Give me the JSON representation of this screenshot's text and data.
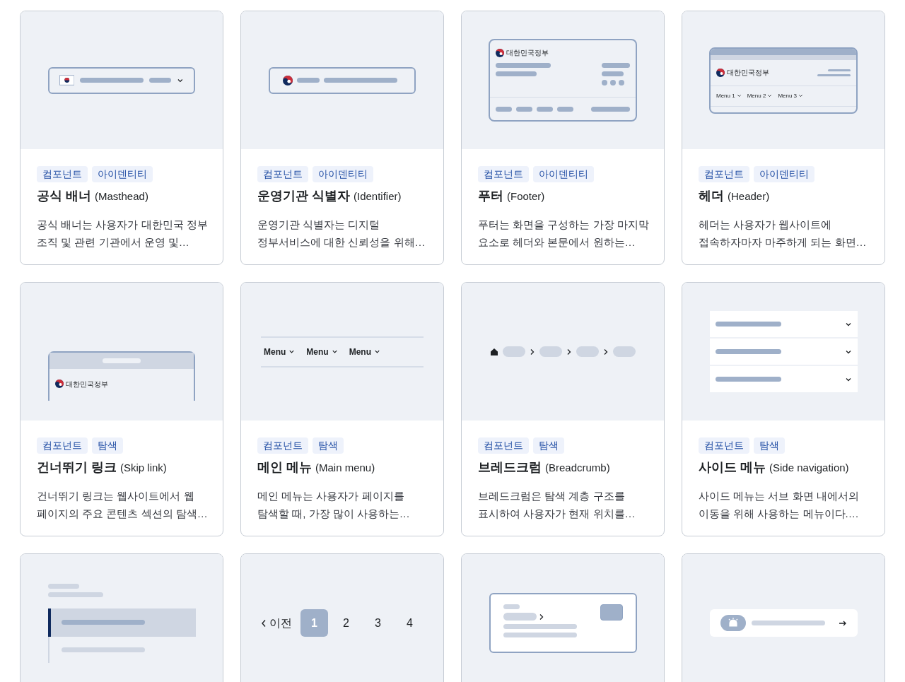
{
  "cards": [
    {
      "preview": {
        "kind": "masthead"
      },
      "tags": [
        "컴포넌트",
        "아이덴티티"
      ],
      "title": "공식 배너",
      "subtitle": "(Masthead)",
      "description": [
        "공식 배너는 사용자가 대한민국 정부",
        "조직 및 관련 기관에서 운영 및…"
      ]
    },
    {
      "preview": {
        "kind": "identifier"
      },
      "tags": [
        "컴포넌트",
        "아이덴티티"
      ],
      "title": "운영기관 식별자",
      "subtitle": "(Identifier)",
      "description": [
        "운영기관 식별자는 디지털",
        "정부서비스에 대한 신뢰성을 위해…"
      ]
    },
    {
      "preview": {
        "kind": "footer",
        "logo_text": "대한민국정부"
      },
      "tags": [
        "컴포넌트",
        "아이덴티티"
      ],
      "title": "푸터",
      "subtitle": "(Footer)",
      "description": [
        "푸터는 화면을 구성하는 가장 마지막",
        "요소로 헤더와 본문에서 원하는…"
      ]
    },
    {
      "preview": {
        "kind": "header",
        "logo_text": "대한민국정부",
        "menus": [
          "Menu 1",
          "Menu 2",
          "Menu 3"
        ]
      },
      "tags": [
        "컴포넌트",
        "아이덴티티"
      ],
      "title": "헤더",
      "subtitle": "(Header)",
      "description": [
        "헤더는 사용자가 웹사이트에",
        "접속하자마자 마주하게 되는 화면…"
      ]
    },
    {
      "preview": {
        "kind": "skip_link",
        "logo_text": "대한민국정부"
      },
      "tags": [
        "컴포넌트",
        "탐색"
      ],
      "title": "건너뛰기 링크",
      "subtitle": "(Skip link)",
      "description": [
        "건너뛰기 링크는 웹사이트에서 웹",
        "페이지의 주요 콘텐츠 섹션의 탐색…"
      ]
    },
    {
      "preview": {
        "kind": "main_menu",
        "menus": [
          "Menu",
          "Menu",
          "Menu"
        ]
      },
      "tags": [
        "컴포넌트",
        "탐색"
      ],
      "title": "메인 메뉴",
      "subtitle": "(Main menu)",
      "description": [
        "메인 메뉴는 사용자가 페이지를",
        "탐색할 때, 가장 많이 사용하는…"
      ]
    },
    {
      "preview": {
        "kind": "breadcrumb"
      },
      "tags": [
        "컴포넌트",
        "탐색"
      ],
      "title": "브레드크럼",
      "subtitle": "(Breadcrumb)",
      "description": [
        "브레드크럼은 탐색 계층 구조를",
        "표시하여 사용자가 현재 위치를…"
      ]
    },
    {
      "preview": {
        "kind": "side_nav"
      },
      "tags": [
        "컴포넌트",
        "탐색"
      ],
      "title": "사이드 메뉴",
      "subtitle": "(Side navigation)",
      "description": [
        "사이드 메뉴는 서브 화면 내에서의",
        "이동을 위해 사용하는 메뉴이다.…"
      ]
    },
    {
      "preview": {
        "kind": "in_page_nav"
      }
    },
    {
      "preview": {
        "kind": "pagination",
        "prev": "이전",
        "pages": [
          {
            "label": "1",
            "selected": true
          },
          {
            "label": "2",
            "selected": false
          },
          {
            "label": "3",
            "selected": false
          },
          {
            "label": "4",
            "selected": false
          }
        ]
      }
    },
    {
      "preview": {
        "kind": "card_link"
      }
    },
    {
      "preview": {
        "kind": "banner_link"
      }
    }
  ]
}
